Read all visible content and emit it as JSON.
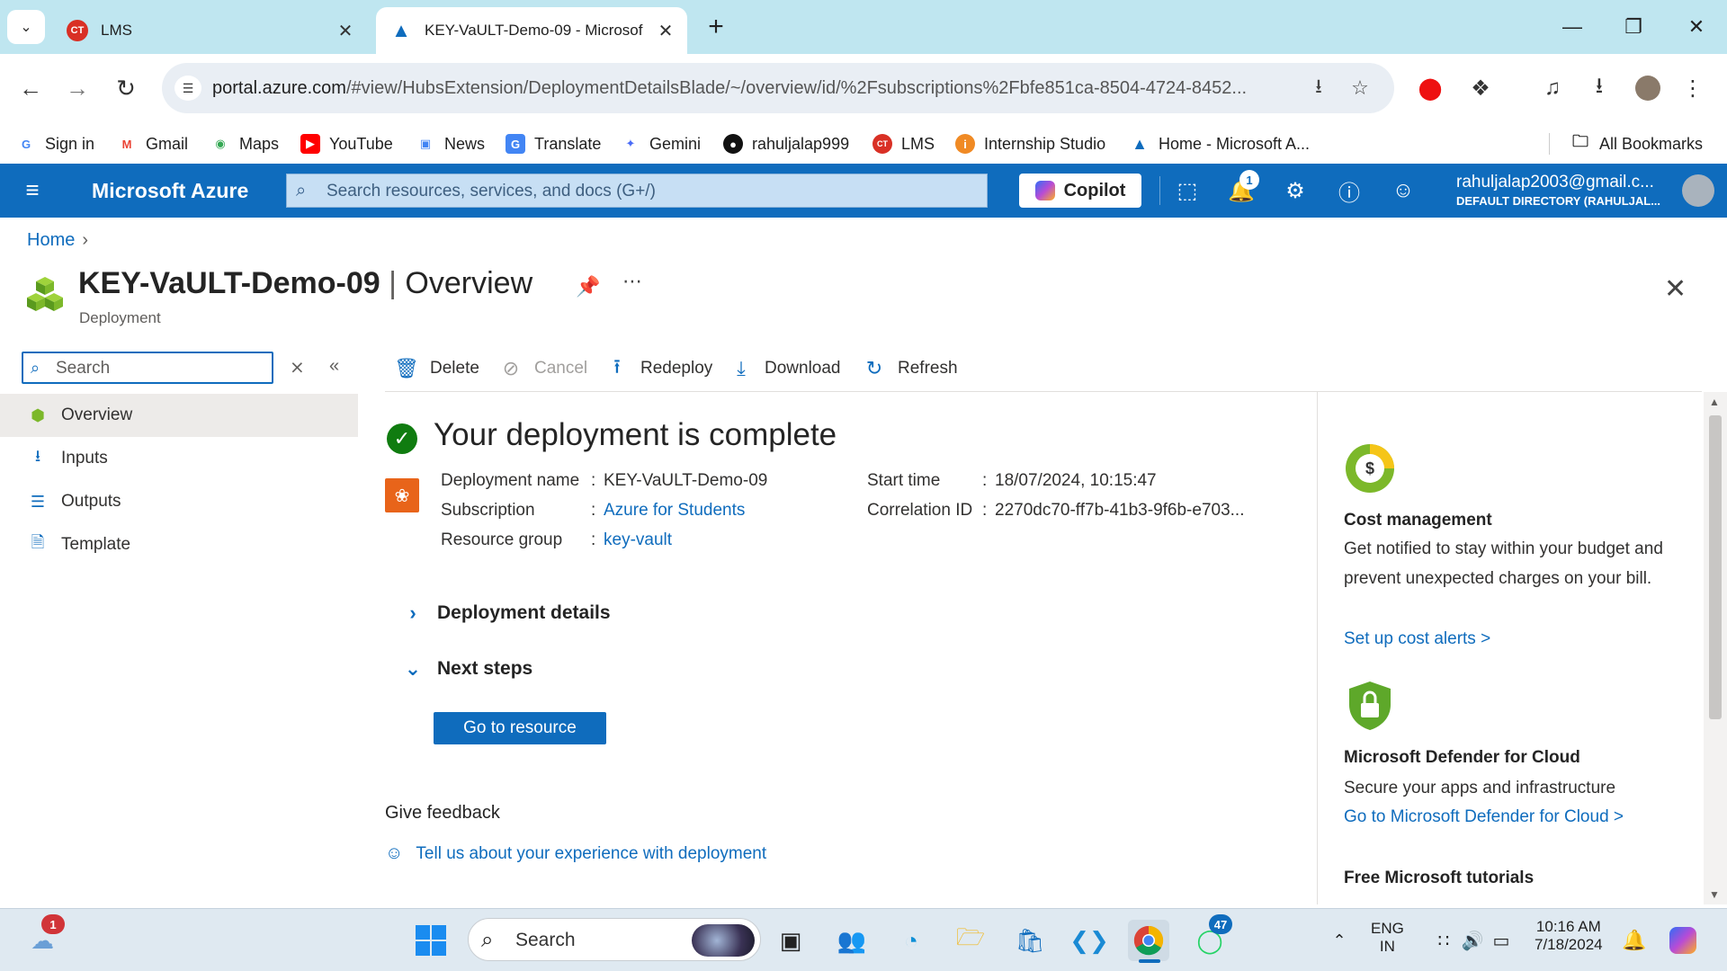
{
  "browser": {
    "tabs": [
      {
        "title": "LMS",
        "active": false
      },
      {
        "title": "KEY-VaULT-Demo-09 - Microsof",
        "active": true
      }
    ],
    "url_host": "portal.azure.com",
    "url_path": "/#view/HubsExtension/DeploymentDetailsBlade/~/overview/id/%2Fsubscriptions%2Fbfe851ca-8504-4724-8452...",
    "bookmarks": [
      "Sign in",
      "Gmail",
      "Maps",
      "YouTube",
      "News",
      "Translate",
      "Gemini",
      "rahuljalap999",
      "LMS",
      "Internship Studio",
      "Home - Microsoft A..."
    ],
    "all_bookmarks": "All Bookmarks"
  },
  "azure": {
    "brand": "Microsoft Azure",
    "search_placeholder": "Search resources, services, and docs (G+/)",
    "copilot": "Copilot",
    "notifications_count": "1",
    "account_email": "rahuljalap2003@gmail.c...",
    "account_directory": "DEFAULT DIRECTORY (RAHULJAL..."
  },
  "breadcrumb": {
    "home": "Home"
  },
  "page": {
    "title": "KEY-VaULT-Demo-09",
    "view": "Overview",
    "subtitle": "Deployment"
  },
  "menu": {
    "search_placeholder": "Search",
    "items": [
      "Overview",
      "Inputs",
      "Outputs",
      "Template"
    ]
  },
  "commands": {
    "delete": "Delete",
    "cancel": "Cancel",
    "redeploy": "Redeploy",
    "download": "Download",
    "refresh": "Refresh"
  },
  "deployment": {
    "headline": "Your deployment is complete",
    "name_label": "Deployment name",
    "name_value": "KEY-VaULT-Demo-09",
    "subscription_label": "Subscription",
    "subscription_value": "Azure for Students",
    "rg_label": "Resource group",
    "rg_value": "key-vault",
    "start_label": "Start time",
    "start_value": "18/07/2024, 10:15:47",
    "corr_label": "Correlation ID",
    "corr_value": "2270dc70-ff7b-41b3-9f6b-e703...",
    "details_section": "Deployment details",
    "next_section": "Next steps",
    "go_button": "Go to resource",
    "feedback_title": "Give feedback",
    "feedback_link": "Tell us about your experience with deployment"
  },
  "right_panel": {
    "cost_title": "Cost management",
    "cost_text": "Get notified to stay within your budget and prevent unexpected charges on your bill.",
    "cost_link": "Set up cost alerts >",
    "defender_title": "Microsoft Defender for Cloud",
    "defender_text": "Secure your apps and infrastructure",
    "defender_link": "Go to Microsoft Defender for Cloud >",
    "tutorials_title": "Free Microsoft tutorials"
  },
  "taskbar": {
    "weather_badge": "1",
    "search_placeholder": "Search",
    "whatsapp_badge": "47",
    "lang_top": "ENG",
    "lang_bottom": "IN",
    "time": "10:16 AM",
    "date": "7/18/2024"
  },
  "colors": {
    "azure_blue": "#0f6cbd",
    "success_green": "#107c10",
    "chrome_tabstrip": "#bfe6f0"
  }
}
